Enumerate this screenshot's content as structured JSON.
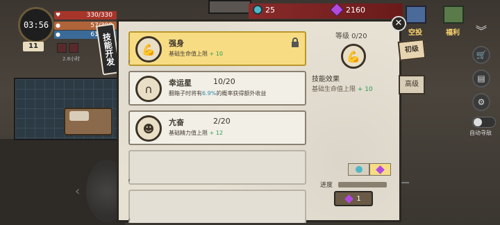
{
  "hud": {
    "clock": "03:56",
    "day": "11",
    "hp": "330/330",
    "food": "57/300",
    "water": "61/412",
    "timer": "2.8小时"
  },
  "currency": {
    "coins": "25",
    "gems": "2160"
  },
  "right_menu": {
    "airdrop_label": "空投",
    "welfare_label": "福利",
    "auto_label": "自动寻敌"
  },
  "panel": {
    "tab_label": "技能开发",
    "skills": [
      {
        "name": "强身",
        "level": "",
        "desc_prefix": "基础生命值上限",
        "desc_value": "+ 10",
        "selected": true,
        "locked": true
      },
      {
        "name": "幸运星",
        "level": "10/20",
        "desc_prefix": "翻箱子时将有",
        "desc_pct": "6.9%",
        "desc_suffix": "的概率获得额外收益",
        "selected": false
      },
      {
        "name": "亢奋",
        "level": "2/20",
        "desc_prefix": "基础精力值上限",
        "desc_value": "+ 12",
        "selected": false
      }
    ],
    "detail": {
      "level_line": "等级 0/20",
      "effect_title": "技能效果",
      "effect_text": "基础生命值上限",
      "effect_value": "+ 10"
    },
    "side_tabs": {
      "basic": "初级",
      "advanced": "高级"
    },
    "progress_label": "进度",
    "cost": "1",
    "close": "✕"
  },
  "icons": {
    "coin": "coin-icon",
    "gem": "gem-icon",
    "lock": "lock-icon",
    "muscle": "muscle-icon",
    "luck": "horseshoe-icon",
    "brain": "brain-icon"
  },
  "colors": {
    "selected_card": "#f7dc84",
    "bonus_green": "#2a9a52",
    "percent_blue": "#2a88a8",
    "gem_purple": "#b04ae0",
    "coin_teal": "#4fb8c8"
  }
}
